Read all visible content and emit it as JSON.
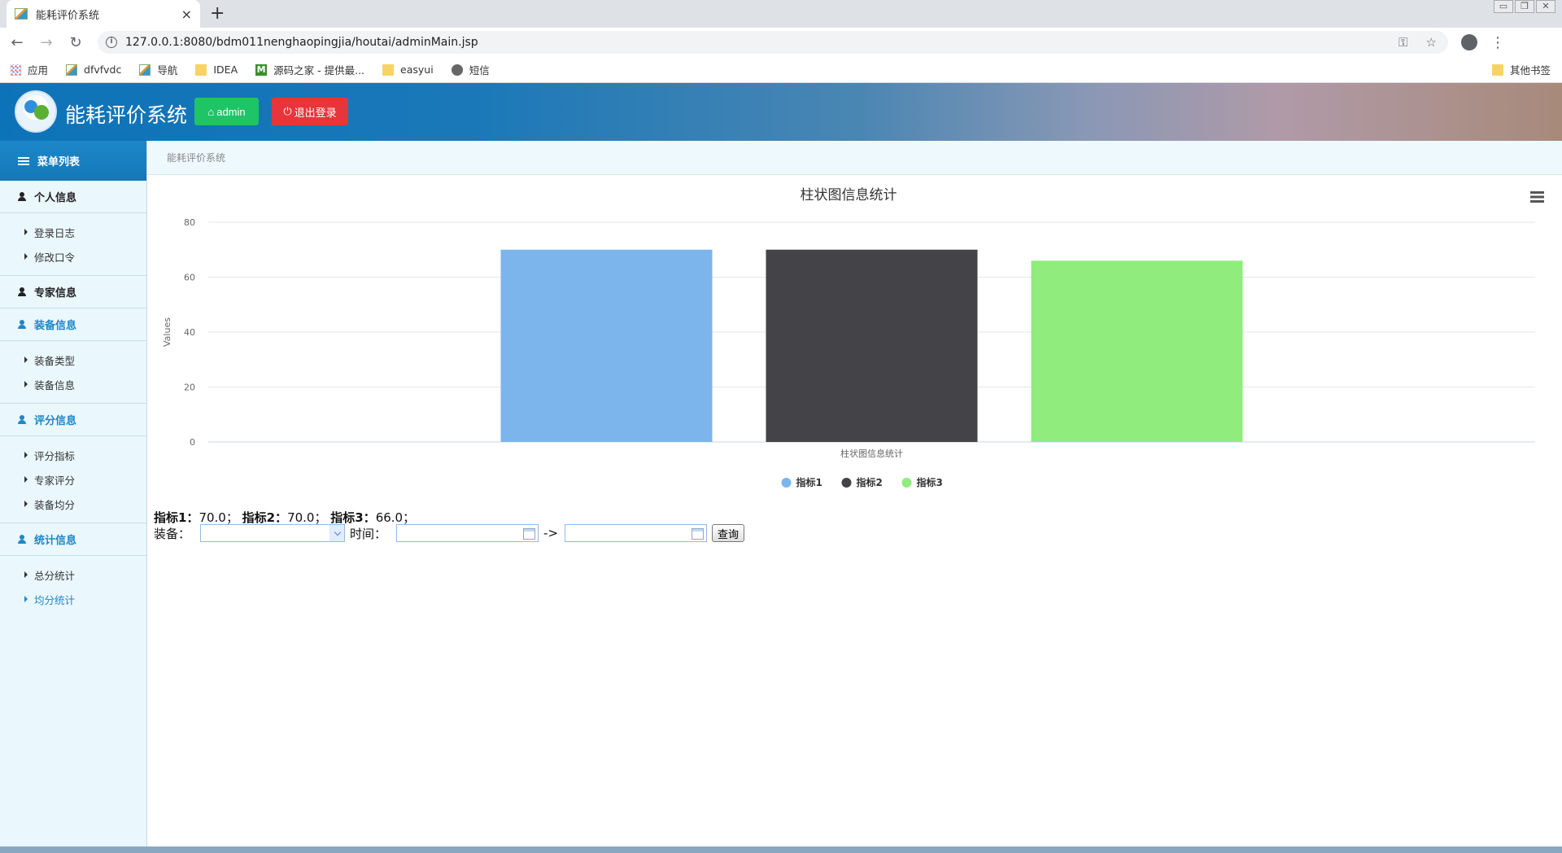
{
  "browser": {
    "tab_title": "能耗评价系统",
    "tab_close": "×",
    "new_tab": "+",
    "url": "127.0.0.1:8080/bdm011nenghaopingjia/houtai/adminMain.jsp",
    "bookmarks": [
      "应用",
      "dfvfvdc",
      "导航",
      "IDEA",
      "源码之家 - 提供最...",
      "easyui",
      "短信"
    ],
    "other_bookmarks": "其他书签"
  },
  "header": {
    "title": "能耗评价系统",
    "admin_label": "admin",
    "logout_label": "退出登录"
  },
  "sidebar": {
    "title": "菜单列表",
    "groups": [
      {
        "label": "个人信息",
        "items": [
          "登录日志",
          "修改口令"
        ]
      },
      {
        "label": "专家信息",
        "items": []
      },
      {
        "label": "装备信息",
        "items": [
          "装备类型",
          "装备信息"
        ]
      },
      {
        "label": "评分信息",
        "items": [
          "评分指标",
          "专家评分",
          "装备均分"
        ]
      },
      {
        "label": "统计信息",
        "items": [
          "总分统计",
          "均分统计"
        ]
      }
    ]
  },
  "breadcrumb": "能耗评价系统",
  "chart_data": {
    "type": "bar",
    "title": "柱状图信息统计",
    "xlabel": "柱状图信息统计",
    "ylabel": "Values",
    "ylim": [
      0,
      80
    ],
    "yticks": [
      0,
      20,
      40,
      60,
      80
    ],
    "grid": true,
    "legend_position": "bottom",
    "series": [
      {
        "name": "指标1",
        "values": [
          70.0
        ],
        "color": "#7cb5ec"
      },
      {
        "name": "指标2",
        "values": [
          70.0
        ],
        "color": "#434348"
      },
      {
        "name": "指标3",
        "values": [
          66.0
        ],
        "color": "#90ed7d"
      }
    ]
  },
  "summary": {
    "k1": "指标1：",
    "v1": "70.0；",
    "k2": "指标2：",
    "v2": "70.0；",
    "k3": "指标3：",
    "v3": "66.0；"
  },
  "filters": {
    "equipment_label": "装备：",
    "time_label": "时间：",
    "arrow": "->",
    "query_label": "查询"
  }
}
